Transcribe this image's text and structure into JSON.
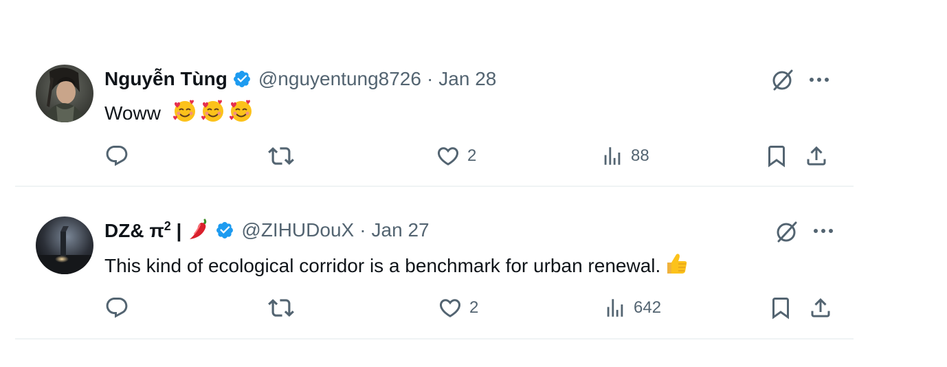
{
  "colors": {
    "text_primary": "#0f1419",
    "text_secondary": "#536471",
    "verified_blue": "#1d9bf0",
    "divider": "#eff3f4"
  },
  "tweets": [
    {
      "display_name": "Nguyễn Tùng",
      "verified": true,
      "handle": "@nguyentung8726",
      "separator": "·",
      "date": "Jan 28",
      "text": "Woww",
      "text_emojis": [
        "smiling-face-with-hearts-emoji",
        "smiling-face-with-hearts-emoji",
        "smiling-face-with-hearts-emoji"
      ],
      "actions": {
        "reply_count": "",
        "repost_count": "",
        "like_count": "2",
        "views_count": "88"
      }
    },
    {
      "display_name_prefix": "DZ& π",
      "display_name_sup": "2",
      "display_name_suffix": " |",
      "name_emoji": "hot-pepper-emoji",
      "verified": true,
      "handle": "@ZIHUDouX",
      "separator": "·",
      "date": "Jan 27",
      "text": "This kind of ecological corridor is a benchmark for urban renewal.",
      "text_emojis": [
        "thumbs-up-emoji"
      ],
      "actions": {
        "reply_count": "",
        "repost_count": "",
        "like_count": "2",
        "views_count": "642"
      }
    }
  ]
}
